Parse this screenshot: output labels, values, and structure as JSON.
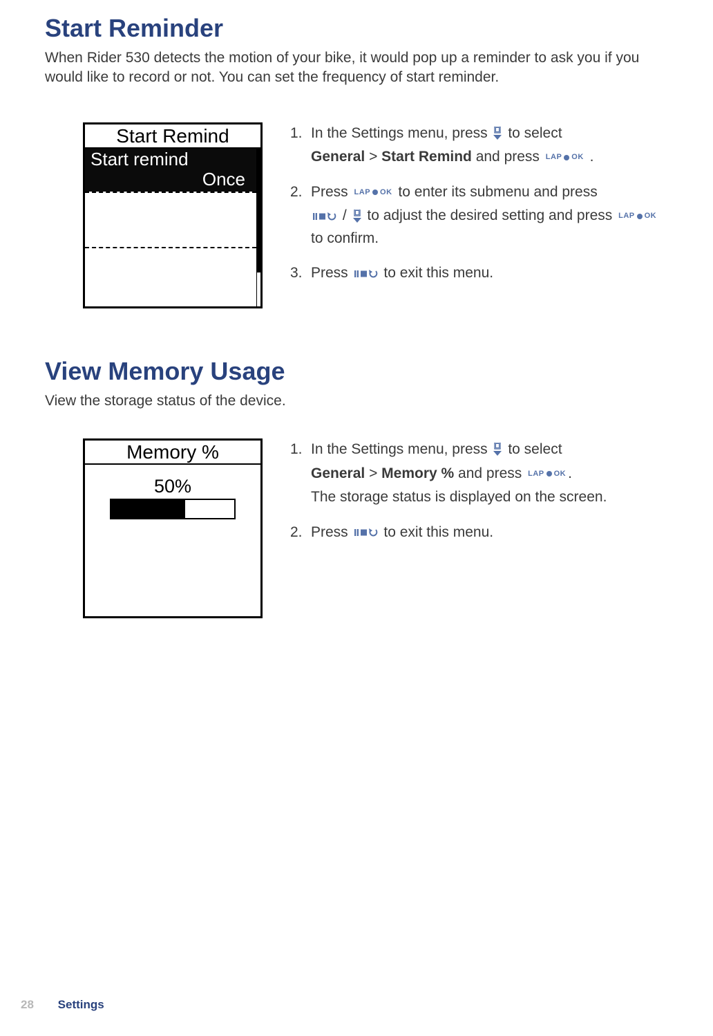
{
  "section1": {
    "title": "Start Reminder",
    "intro": "When Rider 530 detects the motion of your bike, it would pop up a reminder to ask you if you would like to record or not. You can set the frequency of start reminder.",
    "device": {
      "header": "Start Remind",
      "row_label": "Start remind",
      "row_value": "Once"
    },
    "steps": {
      "s1_a": "In the Settings menu, press",
      "s1_b": "to select",
      "s1_path1": "General",
      "s1_gt": ">",
      "s1_path2": "Start Remind",
      "s1_c": "and press",
      "s1_end": ".",
      "s2_a": "Press",
      "s2_b": "to enter its submenu and press",
      "s2_slash": "/",
      "s2_c": "to adjust the desired setting and press",
      "s2_d": "to confirm.",
      "s3_a": "Press",
      "s3_b": "to exit this menu."
    }
  },
  "section2": {
    "title": "View Memory Usage",
    "intro": "View the storage status of the device.",
    "device": {
      "header": "Memory %",
      "value": "50%"
    },
    "steps": {
      "s1_a": "In the Settings menu, press",
      "s1_b": "to select",
      "s1_path1": "General",
      "s1_gt": ">",
      "s1_path2": "Memory %",
      "s1_c": "and press",
      "s1_end": ".",
      "s1_d": "The storage status is displayed on the screen.",
      "s2_a": "Press",
      "s2_b": "to exit this menu."
    }
  },
  "icons": {
    "lap": "LAP",
    "ok": "OK"
  },
  "footer": {
    "page": "28",
    "section": "Settings"
  }
}
